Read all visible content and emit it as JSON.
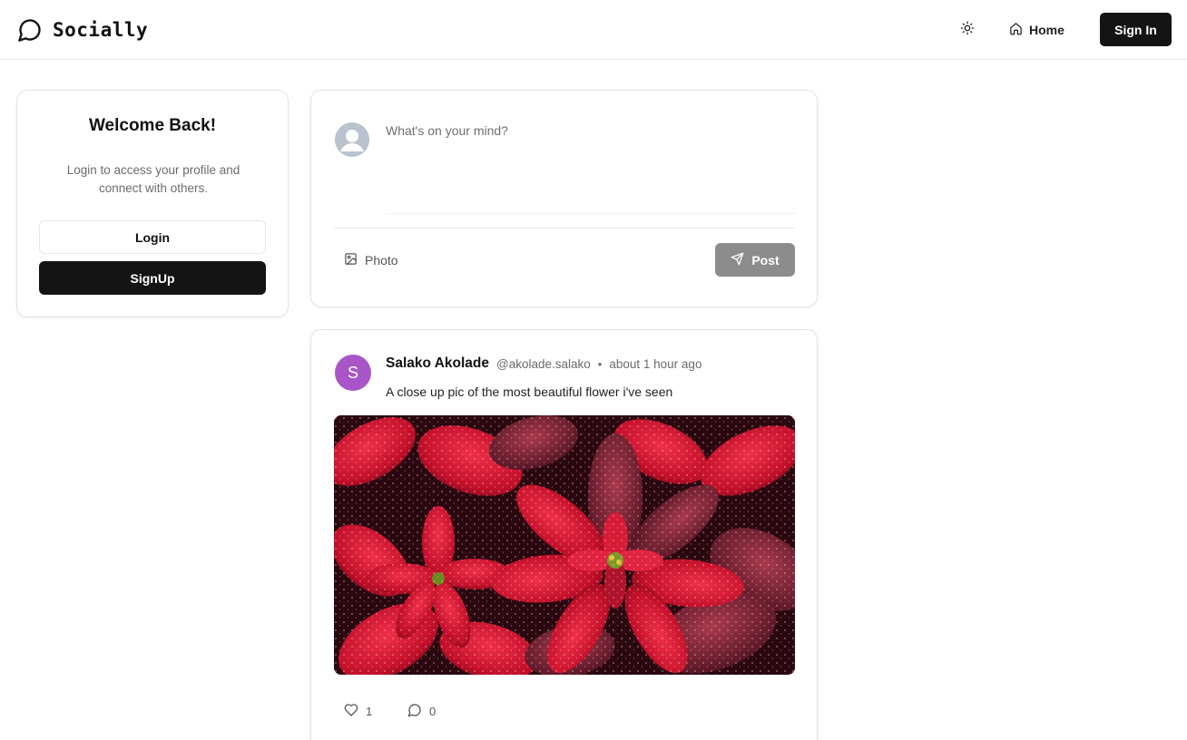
{
  "app": {
    "name": "Socially"
  },
  "nav": {
    "home_label": "Home",
    "signin_label": "Sign In"
  },
  "welcome": {
    "title": "Welcome Back!",
    "description": "Login to access your profile and connect with others.",
    "login_label": "Login",
    "signup_label": "SignUp"
  },
  "composer": {
    "placeholder": "What's on your mind?",
    "photo_label": "Photo",
    "post_label": "Post"
  },
  "post": {
    "avatar_initial": "S",
    "avatar_color": "#a855c7",
    "author": "Salako Akolade",
    "handle": "@akolade.salako",
    "separator": "•",
    "time": "about 1 hour ago",
    "content": "A close up pic of the most beautiful flower i've seen",
    "image_subject": "red poinsettia leaves with water droplets",
    "likes": "1",
    "comments": "0"
  },
  "icons": {
    "brand": "speech-bubble-icon",
    "theme": "sun-icon",
    "home": "home-icon",
    "photo": "image-icon",
    "post": "send-icon",
    "like": "heart-icon",
    "comment": "comment-icon"
  },
  "colors": {
    "primary": "#141414",
    "post_disabled": "#8c8c8c",
    "border": "#e3e3e3"
  }
}
